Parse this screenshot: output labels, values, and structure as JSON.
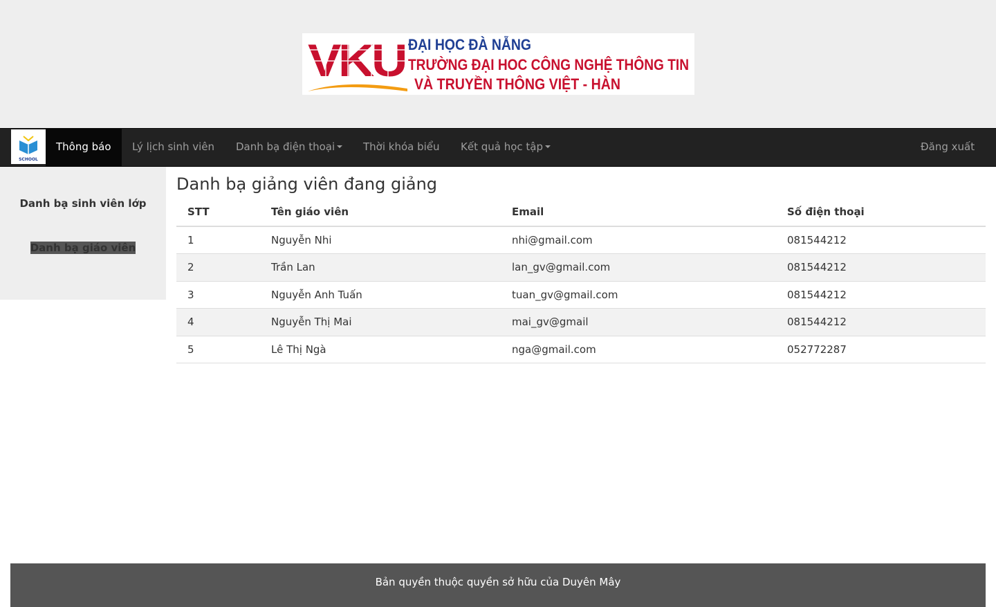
{
  "banner": {
    "logo_text": "VKU",
    "line1": "ĐẠI HỌC ĐÀ NẴNG",
    "line2": "TRƯỜNG ĐẠI HOC CÔNG NGHỆ THÔNG TIN",
    "line3": "VÀ TRUYỀN THÔNG VIỆT - HÀN"
  },
  "navbar": {
    "brand_icon": "school-book-icon",
    "brand_text": "SCHOOL",
    "items": [
      {
        "label": "Thông báo",
        "active": true
      },
      {
        "label": "Lý lịch sinh viên"
      },
      {
        "label": "Danh bạ điện thoại",
        "dropdown": true
      },
      {
        "label": "Thời khóa biểu"
      },
      {
        "label": "Kết quả học tập",
        "dropdown": true
      }
    ],
    "logout": "Đăng xuất"
  },
  "sidebar": {
    "items": [
      {
        "label": "Danh bạ sinh viên lớp"
      },
      {
        "label": "Danh bạ giáo viên",
        "selected": true
      }
    ]
  },
  "main": {
    "title": "Danh bạ giảng viên đang giảng",
    "columns": [
      "STT",
      "Tên giáo viên",
      "Email",
      "Số điện thoại"
    ],
    "rows": [
      [
        "1",
        "Nguyễn Nhi",
        "nhi@gmail.com",
        "081544212"
      ],
      [
        "2",
        "Trần Lan",
        "lan_gv@gmail.com",
        "081544212"
      ],
      [
        "3",
        "Nguyễn Anh Tuấn",
        "tuan_gv@gmail.com",
        "081544212"
      ],
      [
        "4",
        "Nguyễn Thị Mai",
        "mai_gv@gmail",
        "081544212"
      ],
      [
        "5",
        "Lê Thị Ngà",
        "nga@gmail.com",
        "052772287"
      ]
    ]
  },
  "footer": {
    "text": "Bản quyền thuộc quyền sở hữu của Duyên Mây"
  },
  "colors": {
    "navbar_bg": "#222222",
    "header_bg": "#eeeeee",
    "footer_bg": "#555555",
    "logo_red": "#c8102e",
    "logo_blue": "#1f3f94",
    "logo_orange": "#f39c12"
  }
}
